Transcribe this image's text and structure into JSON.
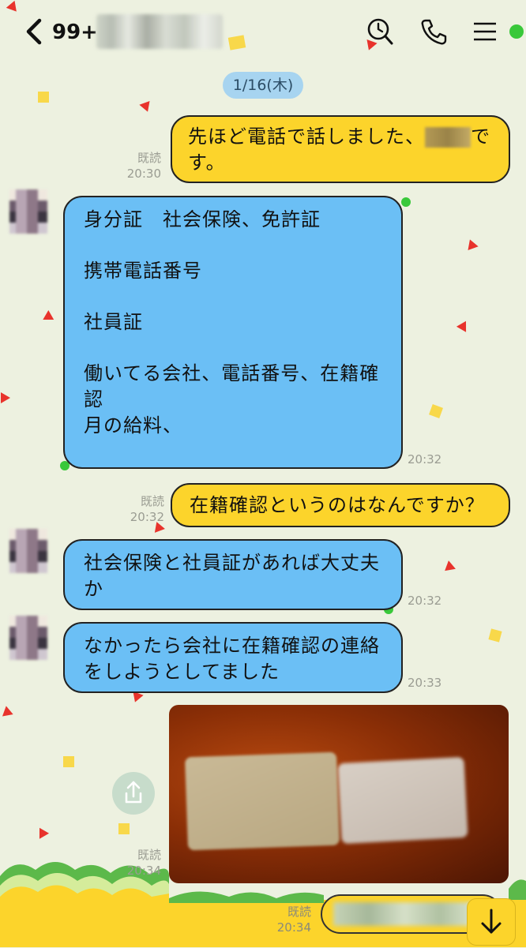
{
  "header": {
    "back_label": "<",
    "unread_count": "99+",
    "icons": [
      "search-clock-icon",
      "phone-icon",
      "menu-icon"
    ]
  },
  "date_label": "1/16(木)",
  "messages": [
    {
      "side": "sent",
      "read": "既読",
      "time": "20:30",
      "line1": "先ほど電話で話しました、",
      "line1_tail": "で",
      "line2": "す。"
    },
    {
      "side": "received",
      "time": "20:32",
      "lines": [
        "身分証　社会保険、免許証",
        "",
        "携帯電話番号",
        "",
        "社員証",
        "",
        "働いてる会社、電話番号、在籍確",
        "認",
        "月の給料、"
      ]
    },
    {
      "side": "sent",
      "read": "既読",
      "time": "20:32",
      "text": "在籍確認というのはなんですか？"
    },
    {
      "side": "received",
      "time": "20:32",
      "lines": [
        "社会保険と社員証があれば大丈夫",
        "か"
      ]
    },
    {
      "side": "received",
      "time": "20:33",
      "lines": [
        "なかったら会社に在籍確認の連絡",
        "をしようとしてました"
      ]
    },
    {
      "side": "sent",
      "read": "既読",
      "time": "20:34",
      "type": "photo"
    },
    {
      "side": "sent",
      "read": "既読",
      "time": "20:34",
      "type": "redacted"
    }
  ],
  "colors": {
    "sent_bubble": "#fcd42b",
    "received_bubble": "#6bbff5",
    "background": "#edf1e0",
    "date_pill": "#a7d4f0"
  }
}
